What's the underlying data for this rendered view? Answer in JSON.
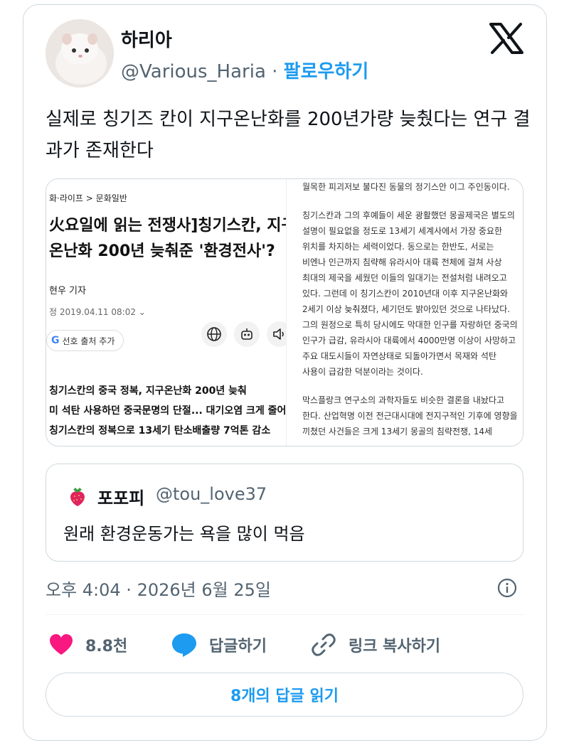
{
  "author": {
    "display_name": "하리아",
    "handle": "@Various_Haria",
    "separator": "·",
    "follow_label": "팔로우하기"
  },
  "tweet": {
    "text": "실제로 칭기즈 칸이 지구온난화를 200년가량 늦췄다는 연구 결과가 존재한다"
  },
  "media": {
    "left": {
      "category": "화·라이프 > 문화일반",
      "headline_line1": "火요일에 읽는 전쟁사]칭기스칸, 지구",
      "headline_line2": "온난화 200년 늦춰준 '환경전사'?",
      "author": "현우 기자",
      "date": "정 2019.04.11 08:02",
      "preferred_source": "선호 출처 추가",
      "summary": [
        "칭기스칸의 중국 정복, 지구온난화 200년 늦춰",
        "미 석탄 사용하던 중국문명의 단절... 대기오염 크게 줄어",
        "칭기스칸의 정복으로 13세기 탄소배출량 7억톤 감소"
      ]
    },
    "right": {
      "paragraphs": [
        "월목한 피괴저보 불다진 동물의 정기스안 이그 주인동이다.",
        "칭기스칸과 그의 후예들이 세운 광활했던 몽골제국은 별도의 설명이 필요없을 정도로 13세기 세계사에서 가장 중요한 위치를 차지하는 세력이었다. 동으로는 한반도, 서로는 비엔나 인근까지 침략해 유라시아 대륙 전체에 걸쳐 사상 최대의 제국을 세웠던 이들의 일대기는 전설처럼 내려오고 있다. 그런데 이 칭기스칸이 2010년대 이후 지구온난화와 2세기 이상 늦춰졌다, 세기던도 밝아있던 것으로 나타났다. 그의 원정으로 특히 당시에도 막대한 인구를 자랑하던 중국의 인구가 급감, 유라시아 대륙에서 4000만명 이상이 사망하고 주요 대도시들이 자연상태로 되돌아가면서 목재와 석탄 사용이 급감한 덕분이라는 것이다.",
        "막스플랑크 연구소의 과학자들도 비슷한 결론을 내놨다고 한다. 산업혁명 이전 전근대시대에 전지구적인 기후에 영향을 끼쳤던 사건들은 크게 13세기 몽골의 침략전쟁, 14세"
      ]
    }
  },
  "quote": {
    "display_name": "포포피",
    "handle": "@tou_love37",
    "text": "원래 환경운동가는 욕을 많이 먹음"
  },
  "timestamp": "오후 4:04 · 2026년 6월 25일",
  "actions": {
    "like_count": "8.8천",
    "reply_label": "답글하기",
    "copy_link_label": "링크 복사하기"
  },
  "read_replies_label": "8개의 답글 읽기",
  "colors": {
    "accent": "#1d9bf0",
    "like": "#f91880",
    "text_secondary": "#536471",
    "border": "#cfd9de"
  },
  "icons": [
    "x-logo-icon",
    "globe-icon",
    "robot-icon",
    "speaker-icon",
    "strawberry-icon",
    "info-icon",
    "heart-icon",
    "reply-bubble-icon",
    "link-icon",
    "google-g-icon"
  ]
}
